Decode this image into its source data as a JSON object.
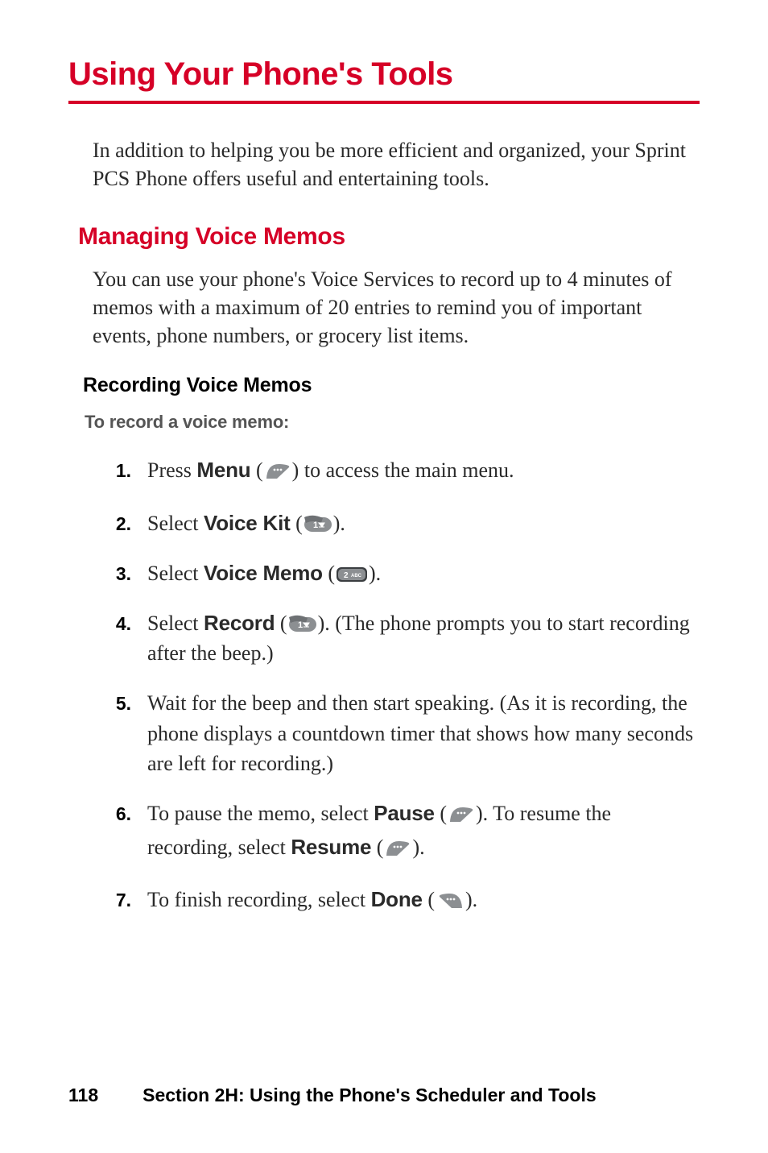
{
  "title": "Using Your Phone's Tools",
  "intro": "In addition to helping you be more efficient and organized, your Sprint PCS Phone offers useful and entertaining tools.",
  "h2": "Managing Voice Memos",
  "para1": "You can use your phone's Voice Services to record up to 4 minutes of memos with a maximum of 20 entries to remind you of important events, phone numbers, or grocery list items.",
  "h3": "Recording Voice Memos",
  "h4": "To record a voice memo:",
  "steps": {
    "s1": {
      "num": "1.",
      "pre": "Press ",
      "bold": "Menu",
      "post": " to access the main menu."
    },
    "s2": {
      "num": "2.",
      "pre": "Select ",
      "bold": "Voice Kit"
    },
    "s3": {
      "num": "3.",
      "pre": "Select ",
      "bold": "Voice Memo"
    },
    "s4": {
      "num": "4.",
      "pre": "Select ",
      "bold": "Record",
      "post": ". (The phone prompts you to start recording after the beep.)"
    },
    "s5": {
      "num": "5.",
      "text": "Wait for the beep and then start speaking. (As it is recording, the phone displays a countdown timer that shows how many seconds are left for recording.)"
    },
    "s6": {
      "num": "6.",
      "pre": "To pause the memo, select ",
      "bold1": "Pause",
      "mid": ". To resume the recording, select ",
      "bold2": "Resume"
    },
    "s7": {
      "num": "7.",
      "pre": "To finish recording, select ",
      "bold": "Done"
    }
  },
  "footer": {
    "page": "118",
    "section": "Section 2H: Using the Phone's Scheduler and Tools"
  }
}
